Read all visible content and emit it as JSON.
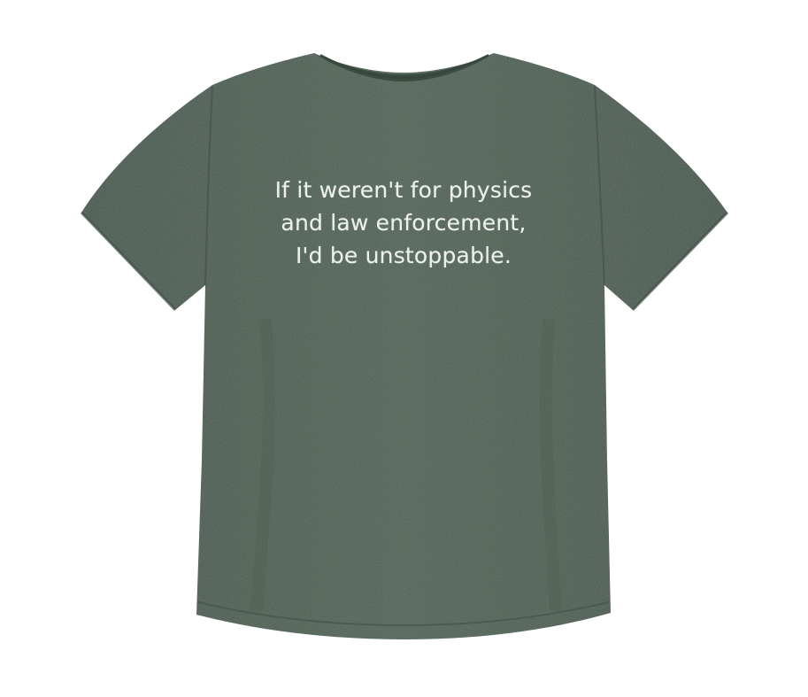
{
  "product": {
    "shirt_color": "#4a5d51",
    "shirt_shade": "#3f5146",
    "shirt_highlight": "#55685b",
    "print_color": "#eef0ec",
    "print_lines": [
      "If it weren't for physics",
      "and law enforcement,",
      "I'd be unstoppable."
    ]
  }
}
